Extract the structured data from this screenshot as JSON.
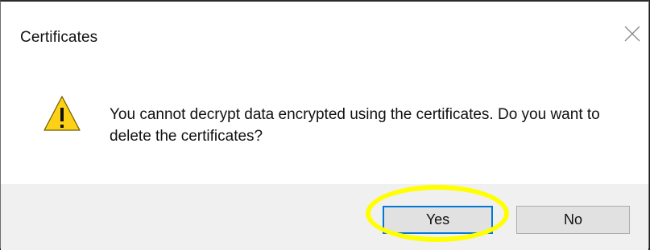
{
  "dialog": {
    "title": "Certificates",
    "message": "You cannot decrypt data encrypted using the certificates. Do you want to delete the certificates?",
    "buttons": {
      "yes_label": "Yes",
      "no_label": "No"
    }
  },
  "icons": {
    "close": "close-icon",
    "warning": "warning-icon"
  },
  "colors": {
    "accent": "#0078d7",
    "warning_fill": "#fcd116",
    "highlight": "#ffff00",
    "footer_background": "#f0f0f0"
  }
}
